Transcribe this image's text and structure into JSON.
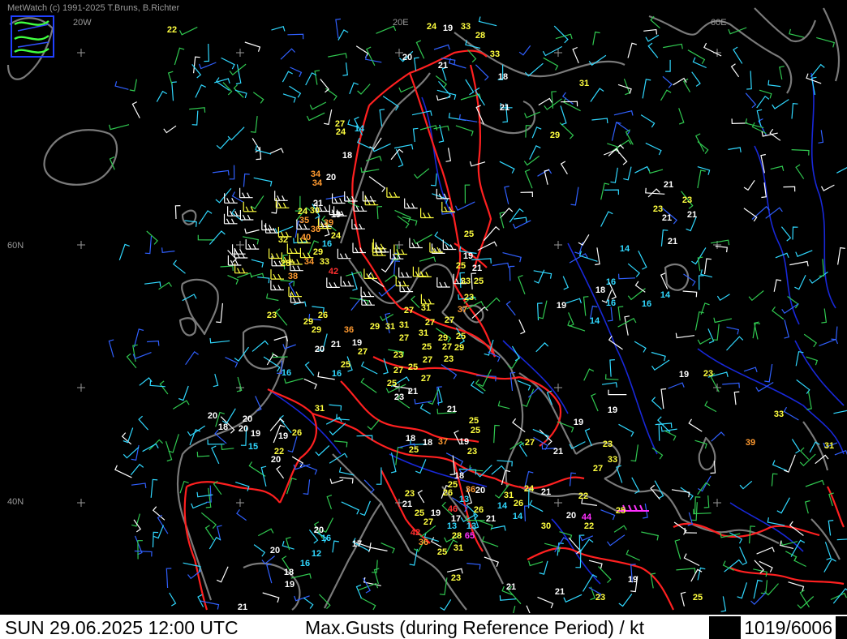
{
  "header": {
    "credit": "MetWatch  (c) 1991-2025 T.Bruns, B.Richter"
  },
  "status_bar": {
    "datetime": "SUN 29.06.2025 12:00 UTC",
    "product": "Max.Gusts (during Reference Period) / kt",
    "counts": "1019/6006"
  },
  "map": {
    "lon_labels": [
      "20W",
      "20E",
      "60E"
    ],
    "lat_labels": [
      "60N",
      "40N"
    ],
    "colors": {
      "background": "#000000",
      "coast": "#7a7a7a",
      "border": "#ff2020",
      "river": "#1828d8",
      "gust_white": "#ffffff",
      "gust_yellow": "#ffff40",
      "gust_cyan": "#30d8ff",
      "gust_orange": "#ff9a30",
      "gust_red": "#ff3030",
      "gust_magenta": "#ff30ff"
    },
    "gusts": [
      {
        "v": "22",
        "c": "yellow"
      },
      {
        "v": "24",
        "c": "yellow"
      },
      {
        "v": "19",
        "c": "white"
      },
      {
        "v": "33",
        "c": "yellow"
      },
      {
        "v": "28",
        "c": "yellow"
      },
      {
        "v": "20",
        "c": "white"
      },
      {
        "v": "21",
        "c": "white"
      },
      {
        "v": "33",
        "c": "yellow"
      },
      {
        "v": "18",
        "c": "white"
      },
      {
        "v": "31",
        "c": "yellow"
      },
      {
        "v": "21",
        "c": "white"
      },
      {
        "v": "27",
        "c": "yellow"
      },
      {
        "v": "24",
        "c": "yellow"
      },
      {
        "v": "14",
        "c": "cyan"
      },
      {
        "v": "29",
        "c": "yellow"
      },
      {
        "v": "18",
        "c": "white"
      },
      {
        "v": "34",
        "c": "orange"
      },
      {
        "v": "34",
        "c": "orange"
      },
      {
        "v": "20",
        "c": "white"
      },
      {
        "v": "21",
        "c": "white"
      },
      {
        "v": "24",
        "c": "yellow"
      },
      {
        "v": "30",
        "c": "yellow"
      },
      {
        "v": "19",
        "c": "white"
      },
      {
        "v": "35",
        "c": "orange"
      },
      {
        "v": "39",
        "c": "orange"
      },
      {
        "v": "36",
        "c": "orange"
      },
      {
        "v": "21",
        "c": "white"
      },
      {
        "v": "23",
        "c": "yellow"
      },
      {
        "v": "23",
        "c": "yellow"
      },
      {
        "v": "21",
        "c": "white"
      },
      {
        "v": "21",
        "c": "white"
      },
      {
        "v": "32",
        "c": "yellow"
      },
      {
        "v": "40",
        "c": "orange"
      },
      {
        "v": "16",
        "c": "cyan"
      },
      {
        "v": "24",
        "c": "yellow"
      },
      {
        "v": "25",
        "c": "yellow"
      },
      {
        "v": "21",
        "c": "white"
      },
      {
        "v": "14",
        "c": "cyan"
      },
      {
        "v": "29",
        "c": "yellow"
      },
      {
        "v": "19",
        "c": "white"
      },
      {
        "v": "28",
        "c": "yellow"
      },
      {
        "v": "34",
        "c": "orange"
      },
      {
        "v": "33",
        "c": "yellow"
      },
      {
        "v": "25",
        "c": "yellow"
      },
      {
        "v": "21",
        "c": "white"
      },
      {
        "v": "42",
        "c": "red"
      },
      {
        "v": "38",
        "c": "orange"
      },
      {
        "v": "33",
        "c": "yellow"
      },
      {
        "v": "25",
        "c": "yellow"
      },
      {
        "v": "16",
        "c": "cyan"
      },
      {
        "v": "18",
        "c": "white"
      },
      {
        "v": "16",
        "c": "cyan"
      },
      {
        "v": "14",
        "c": "cyan"
      },
      {
        "v": "23",
        "c": "yellow"
      },
      {
        "v": "19",
        "c": "white"
      },
      {
        "v": "16",
        "c": "cyan"
      },
      {
        "v": "23",
        "c": "yellow"
      },
      {
        "v": "26",
        "c": "yellow"
      },
      {
        "v": "27",
        "c": "yellow"
      },
      {
        "v": "31",
        "c": "yellow"
      },
      {
        "v": "37",
        "c": "orange"
      },
      {
        "v": "14",
        "c": "cyan"
      },
      {
        "v": "29",
        "c": "yellow"
      },
      {
        "v": "31",
        "c": "yellow"
      },
      {
        "v": "27",
        "c": "yellow"
      },
      {
        "v": "29",
        "c": "yellow"
      },
      {
        "v": "36",
        "c": "orange"
      },
      {
        "v": "27",
        "c": "yellow"
      },
      {
        "v": "29",
        "c": "yellow"
      },
      {
        "v": "31",
        "c": "yellow"
      },
      {
        "v": "31",
        "c": "yellow"
      },
      {
        "v": "27",
        "c": "yellow"
      },
      {
        "v": "29",
        "c": "yellow"
      },
      {
        "v": "25",
        "c": "yellow"
      },
      {
        "v": "20",
        "c": "white"
      },
      {
        "v": "21",
        "c": "white"
      },
      {
        "v": "19",
        "c": "white"
      },
      {
        "v": "27",
        "c": "yellow"
      },
      {
        "v": "25",
        "c": "yellow"
      },
      {
        "v": "27",
        "c": "yellow"
      },
      {
        "v": "29",
        "c": "yellow"
      },
      {
        "v": "23",
        "c": "yellow"
      },
      {
        "v": "27",
        "c": "yellow"
      },
      {
        "v": "23",
        "c": "yellow"
      },
      {
        "v": "16",
        "c": "cyan"
      },
      {
        "v": "16",
        "c": "cyan"
      },
      {
        "v": "25",
        "c": "yellow"
      },
      {
        "v": "27",
        "c": "yellow"
      },
      {
        "v": "25",
        "c": "yellow"
      },
      {
        "v": "27",
        "c": "yellow"
      },
      {
        "v": "19",
        "c": "white"
      },
      {
        "v": "25",
        "c": "yellow"
      },
      {
        "v": "23",
        "c": "yellow"
      },
      {
        "v": "21",
        "c": "white"
      },
      {
        "v": "23",
        "c": "white"
      },
      {
        "v": "21",
        "c": "white"
      },
      {
        "v": "31",
        "c": "yellow"
      },
      {
        "v": "20",
        "c": "white"
      },
      {
        "v": "20",
        "c": "white"
      },
      {
        "v": "18",
        "c": "white"
      },
      {
        "v": "20",
        "c": "white"
      },
      {
        "v": "19",
        "c": "white"
      },
      {
        "v": "26",
        "c": "yellow"
      },
      {
        "v": "25",
        "c": "yellow"
      },
      {
        "v": "25",
        "c": "yellow"
      },
      {
        "v": "19",
        "c": "white"
      },
      {
        "v": "15",
        "c": "cyan"
      },
      {
        "v": "22",
        "c": "yellow"
      },
      {
        "v": "20",
        "c": "white"
      },
      {
        "v": "18",
        "c": "white"
      },
      {
        "v": "25",
        "c": "yellow"
      },
      {
        "v": "18",
        "c": "white"
      },
      {
        "v": "37",
        "c": "orange"
      },
      {
        "v": "19",
        "c": "white"
      },
      {
        "v": "23",
        "c": "yellow"
      },
      {
        "v": "27",
        "c": "yellow"
      },
      {
        "v": "21",
        "c": "white"
      },
      {
        "v": "19",
        "c": "white"
      },
      {
        "v": "19",
        "c": "white"
      },
      {
        "v": "23",
        "c": "yellow"
      },
      {
        "v": "27",
        "c": "yellow"
      },
      {
        "v": "33",
        "c": "yellow"
      },
      {
        "v": "33",
        "c": "yellow"
      },
      {
        "v": "39",
        "c": "orange"
      },
      {
        "v": "31",
        "c": "yellow"
      },
      {
        "v": "18",
        "c": "white"
      },
      {
        "v": "25",
        "c": "yellow"
      },
      {
        "v": "26",
        "c": "yellow"
      },
      {
        "v": "36",
        "c": "orange"
      },
      {
        "v": "13",
        "c": "cyan"
      },
      {
        "v": "20",
        "c": "white"
      },
      {
        "v": "26",
        "c": "yellow"
      },
      {
        "v": "31",
        "c": "yellow"
      },
      {
        "v": "14",
        "c": "cyan"
      },
      {
        "v": "26",
        "c": "yellow"
      },
      {
        "v": "24",
        "c": "yellow"
      },
      {
        "v": "21",
        "c": "white"
      },
      {
        "v": "22",
        "c": "yellow"
      },
      {
        "v": "23",
        "c": "yellow"
      },
      {
        "v": "21",
        "c": "white"
      },
      {
        "v": "25",
        "c": "yellow"
      },
      {
        "v": "19",
        "c": "white"
      },
      {
        "v": "46",
        "c": "red"
      },
      {
        "v": "17",
        "c": "white"
      },
      {
        "v": "21",
        "c": "white"
      },
      {
        "v": "14",
        "c": "cyan"
      },
      {
        "v": "20",
        "c": "white"
      },
      {
        "v": "44",
        "c": "magenta"
      },
      {
        "v": "25",
        "c": "yellow"
      },
      {
        "v": "27",
        "c": "yellow"
      },
      {
        "v": "13",
        "c": "cyan"
      },
      {
        "v": "13",
        "c": "cyan"
      },
      {
        "v": "30",
        "c": "yellow"
      },
      {
        "v": "22",
        "c": "yellow"
      },
      {
        "v": "42",
        "c": "red"
      },
      {
        "v": "28",
        "c": "yellow"
      },
      {
        "v": "65",
        "c": "magenta"
      },
      {
        "v": "36",
        "c": "orange"
      },
      {
        "v": "31",
        "c": "yellow"
      },
      {
        "v": "25",
        "c": "yellow"
      },
      {
        "v": "20",
        "c": "white"
      },
      {
        "v": "16",
        "c": "cyan"
      },
      {
        "v": "17",
        "c": "white"
      },
      {
        "v": "20",
        "c": "white"
      },
      {
        "v": "12",
        "c": "cyan"
      },
      {
        "v": "16",
        "c": "cyan"
      },
      {
        "v": "18",
        "c": "white"
      },
      {
        "v": "19",
        "c": "white"
      },
      {
        "v": "21",
        "c": "white"
      },
      {
        "v": "23",
        "c": "yellow"
      },
      {
        "v": "21",
        "c": "white"
      },
      {
        "v": "21",
        "c": "white"
      },
      {
        "v": "23",
        "c": "yellow"
      },
      {
        "v": "19",
        "c": "white"
      },
      {
        "v": "25",
        "c": "yellow"
      }
    ]
  }
}
